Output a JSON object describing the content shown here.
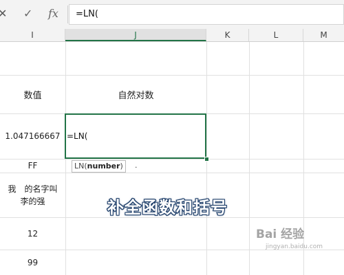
{
  "formula_bar": {
    "cancel_icon": "✕",
    "enter_icon": "✓",
    "fx_label": "fx",
    "formula": "=LN("
  },
  "columns": [
    {
      "label": "I"
    },
    {
      "label": "J",
      "active": true
    },
    {
      "label": "K"
    },
    {
      "label": "L"
    },
    {
      "label": "M"
    }
  ],
  "cells": {
    "i_header": "数值",
    "j_header": "自然对数",
    "i_row1": "1.047166667",
    "j_row1": "=LN(",
    "i_row2": "FF",
    "i_row3_line1": "我　的名字叫",
    "i_row3_line2": "李的强",
    "i_row4": "12",
    "i_row5": "99"
  },
  "tooltip": {
    "func": "LN(",
    "arg": "number",
    "close": ")",
    "trailing": "."
  },
  "caption": "补全函数和括号",
  "watermark": {
    "logo": "Bai 经验",
    "url": "jingyan.baidu.com"
  },
  "colors": {
    "accent": "#217346",
    "caption_stroke": "#1f3f6a"
  }
}
